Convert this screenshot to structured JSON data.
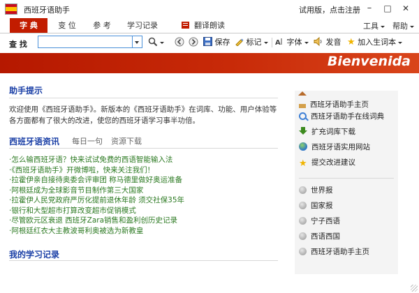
{
  "window": {
    "title": "西班牙语助手",
    "register_text": "试用版，点击注册",
    "minimize": "–",
    "maximize": "□",
    "close": "✕"
  },
  "tabs": [
    {
      "label": "字 典",
      "active": true
    },
    {
      "label": "变 位",
      "active": false
    },
    {
      "label": "参 考",
      "active": false
    },
    {
      "label": "学习记录",
      "active": false
    },
    {
      "label": "翻译朗读",
      "active": false
    }
  ],
  "menu": {
    "tools": "工具",
    "help": "帮助"
  },
  "toolbar": {
    "search_label": "查 找",
    "search_value": "",
    "save": "保存",
    "mark": "标记",
    "font": "字体",
    "speak": "发音",
    "add_vocab": "加入生词本"
  },
  "banner": {
    "text": "Bienvenida"
  },
  "tips": {
    "title": "助手提示",
    "text": "欢迎使用《西班牙语助手》。新版本的《西班牙语助手》在词库、功能、用户体验等各方面都有了很大的改进，使您的西班牙语学习事半功倍。"
  },
  "news": {
    "title": "西班牙语资讯",
    "tab_daily": "每日一句",
    "tab_download": "资源下载",
    "items": [
      "·怎么输西班牙语？快来试试免费的西语智能输入法",
      "·《西班牙语助手》开微博啦，快来关注我们！",
      "·拉霍伊亲自接待奥委会评审团 称马德里做好奥运准备",
      "·阿根廷成为全球影音节目制作第三大国家",
      "·拉霍伊人民党政府严厉化提前退休年龄 须交社保35年",
      "·银行和大型超市打算改变超市促销模式",
      "·尽管欧元区衰退 西班牙Zara销售和盈利创历史记录",
      "·阿根廷红衣大主教波哥利奥被选为新教皇"
    ]
  },
  "records": {
    "title": "我的学习记录"
  },
  "sidebar": {
    "links": [
      {
        "label": "西班牙语助手主页",
        "icon": "home-icon"
      },
      {
        "label": "西班牙语助手在线词典",
        "icon": "search-icon"
      },
      {
        "label": "扩充词库下载",
        "icon": "download-arrow-icon"
      },
      {
        "label": "西班牙语实用网站",
        "icon": "globe-icon"
      },
      {
        "label": "提交改进建议",
        "icon": "star-icon"
      }
    ],
    "radio_links": [
      "世界报",
      "国家报",
      "宁子西语",
      "西语西国",
      "西班牙语助手主页"
    ]
  }
}
